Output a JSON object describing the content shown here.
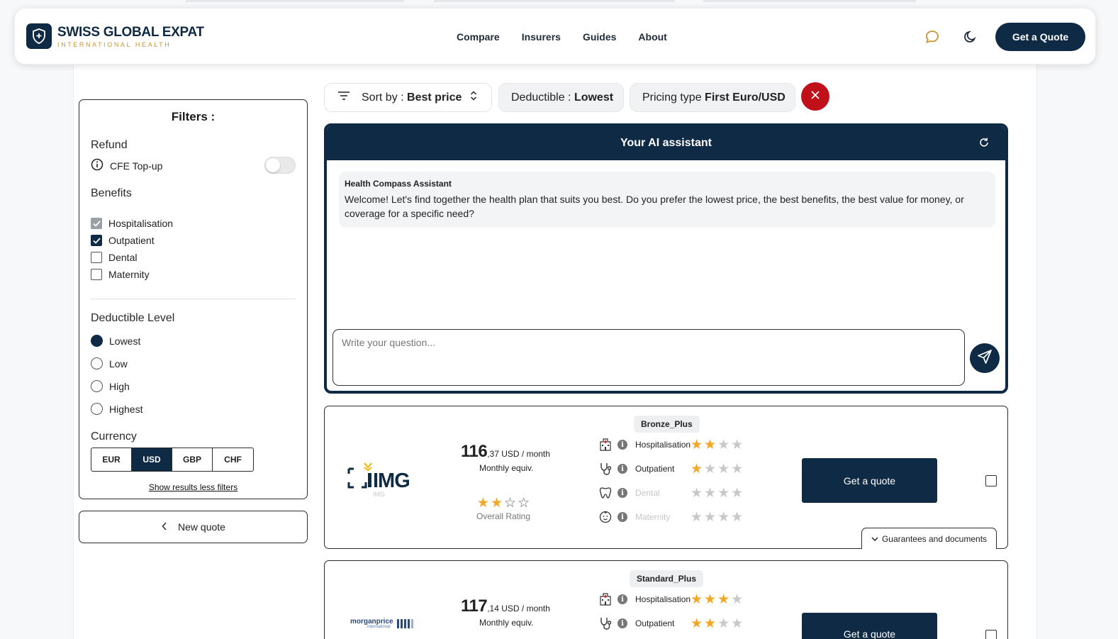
{
  "brand": {
    "name": "SWISS GLOBAL EXPAT",
    "tagline": "INTERNATIONAL HEALTH"
  },
  "nav": {
    "items": [
      "Compare",
      "Insurers",
      "Guides",
      "About"
    ]
  },
  "header": {
    "quote_label": "Get a Quote"
  },
  "filters": {
    "title": "Filters :",
    "refund": {
      "title": "Refund",
      "toggle_label": "CFE Top-up",
      "toggle_on": false
    },
    "benefits": {
      "title": "Benefits",
      "items": [
        {
          "label": "Hospitalisation",
          "checked": true,
          "disabled": true
        },
        {
          "label": "Outpatient",
          "checked": true
        },
        {
          "label": "Dental",
          "checked": false
        },
        {
          "label": "Maternity",
          "checked": false
        }
      ]
    },
    "deductible": {
      "title": "Deductible Level",
      "options": [
        "Lowest",
        "Low",
        "High",
        "Highest"
      ],
      "selected": "Lowest"
    },
    "currency": {
      "title": "Currency",
      "options": [
        "EUR",
        "USD",
        "GBP",
        "CHF"
      ],
      "selected": "USD"
    },
    "show_link": "Show results less filters"
  },
  "new_quote_label": "New quote",
  "toolbar": {
    "sort_prefix": "Sort by : ",
    "sort_value": "Best price",
    "deductible_prefix": "Deductible : ",
    "deductible_value": "Lowest",
    "pricing_prefix": "Pricing type ",
    "pricing_value": "First Euro/USD"
  },
  "assistant": {
    "title": "Your AI assistant",
    "author": "Health Compass Assistant",
    "message": "Welcome! Let's find together the health plan that suits you best. Do you prefer the lowest price, the best benefits, the best value for money, or coverage for a specific need?",
    "placeholder": "Write your question..."
  },
  "offers": [
    {
      "insurer": "IMG",
      "insurer_sub": "IMG",
      "plan": "Bronze_Plus",
      "price_int": "116",
      "price_dec": ",37",
      "price_unit": " USD / month",
      "equiv": "Monthly equiv.",
      "overall_rating": 2,
      "overall_label": "Overall Rating",
      "benefits": [
        {
          "label": "Hospitalisation",
          "rating": 2,
          "icon": "hospital-icon",
          "active": true
        },
        {
          "label": "Outpatient",
          "rating": 1,
          "icon": "stethoscope-icon",
          "active": true
        },
        {
          "label": "Dental",
          "rating": 0,
          "icon": "tooth-icon",
          "active": false
        },
        {
          "label": "Maternity",
          "rating": 0,
          "icon": "baby-icon",
          "active": false
        }
      ],
      "quote_label": "Get a quote",
      "guarantees_label": "Guarantees and documents"
    },
    {
      "insurer": "morganprice",
      "insurer_sub": "international",
      "plan": "Standard_Plus",
      "price_int": "117",
      "price_dec": ",14",
      "price_unit": " USD / month",
      "equiv": "Monthly equiv.",
      "benefits": [
        {
          "label": "Hospitalisation",
          "rating": 3,
          "icon": "hospital-icon",
          "active": true
        },
        {
          "label": "Outpatient",
          "rating": 2,
          "icon": "stethoscope-icon",
          "active": true
        }
      ],
      "quote_label": "Get a quote"
    }
  ],
  "colors": {
    "navy": "#0f2a45",
    "accent_gold": "#c8953a",
    "star": "#f5a623",
    "danger": "#c0101a"
  }
}
